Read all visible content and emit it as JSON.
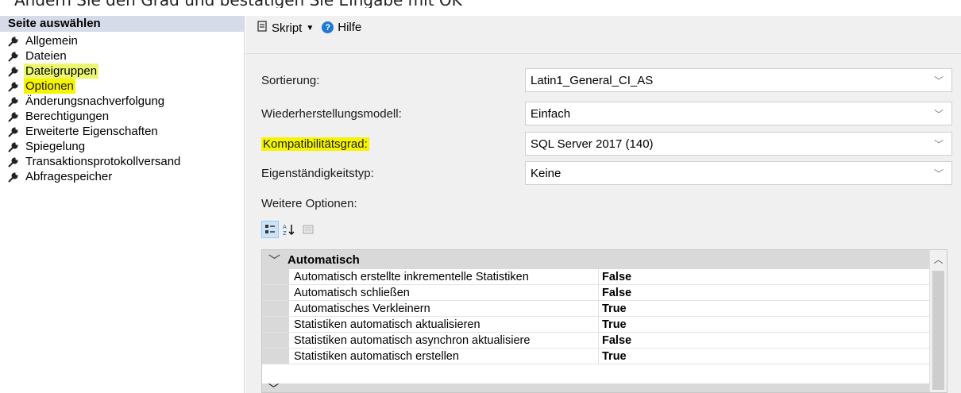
{
  "caption": "Ändern Sie den Grad und bestätigen Sie Eingabe mit OK",
  "sidebar": {
    "header": "Seite auswählen",
    "items": [
      {
        "label": "Allgemein"
      },
      {
        "label": "Dateien"
      },
      {
        "label": "Dateigruppen"
      },
      {
        "label": "Optionen"
      },
      {
        "label": "Änderungsnachverfolgung"
      },
      {
        "label": "Berechtigungen"
      },
      {
        "label": "Erweiterte Eigenschaften"
      },
      {
        "label": "Spiegelung"
      },
      {
        "label": "Transaktionsprotokollversand"
      },
      {
        "label": "Abfragespeicher"
      }
    ]
  },
  "toolbar": {
    "script_label": "Skript",
    "help_label": "Hilfe"
  },
  "form": {
    "collation": {
      "label": "Sortierung:",
      "value": "Latin1_General_CI_AS"
    },
    "recovery": {
      "label": "Wiederherstellungsmodell:",
      "value": "Einfach"
    },
    "compat": {
      "label": "Kompatibilitätsgrad:",
      "value": "SQL Server 2017 (140)"
    },
    "containment": {
      "label": "Eigenständigkeitstyp:",
      "value": "Keine"
    }
  },
  "more_options_label": "Weitere Optionen:",
  "propgrid": {
    "category": "Automatisch",
    "rows": [
      {
        "name": "Automatisch erstellte inkrementelle Statistiken",
        "value": "False"
      },
      {
        "name": "Automatisch schließen",
        "value": "False"
      },
      {
        "name": "Automatisches Verkleinern",
        "value": "True"
      },
      {
        "name": "Statistiken automatisch aktualisieren",
        "value": "True"
      },
      {
        "name": "Statistiken automatisch asynchron aktualisiere",
        "value": "False"
      },
      {
        "name": "Statistiken automatisch erstellen",
        "value": "True"
      }
    ]
  },
  "colors": {
    "highlight": "#f5f500",
    "help_blue": "#1e78d2",
    "header_bg": "#d6dbe9"
  },
  "icons": {
    "nav": "wrench-icon",
    "help": "help-icon",
    "script": "script-icon"
  }
}
